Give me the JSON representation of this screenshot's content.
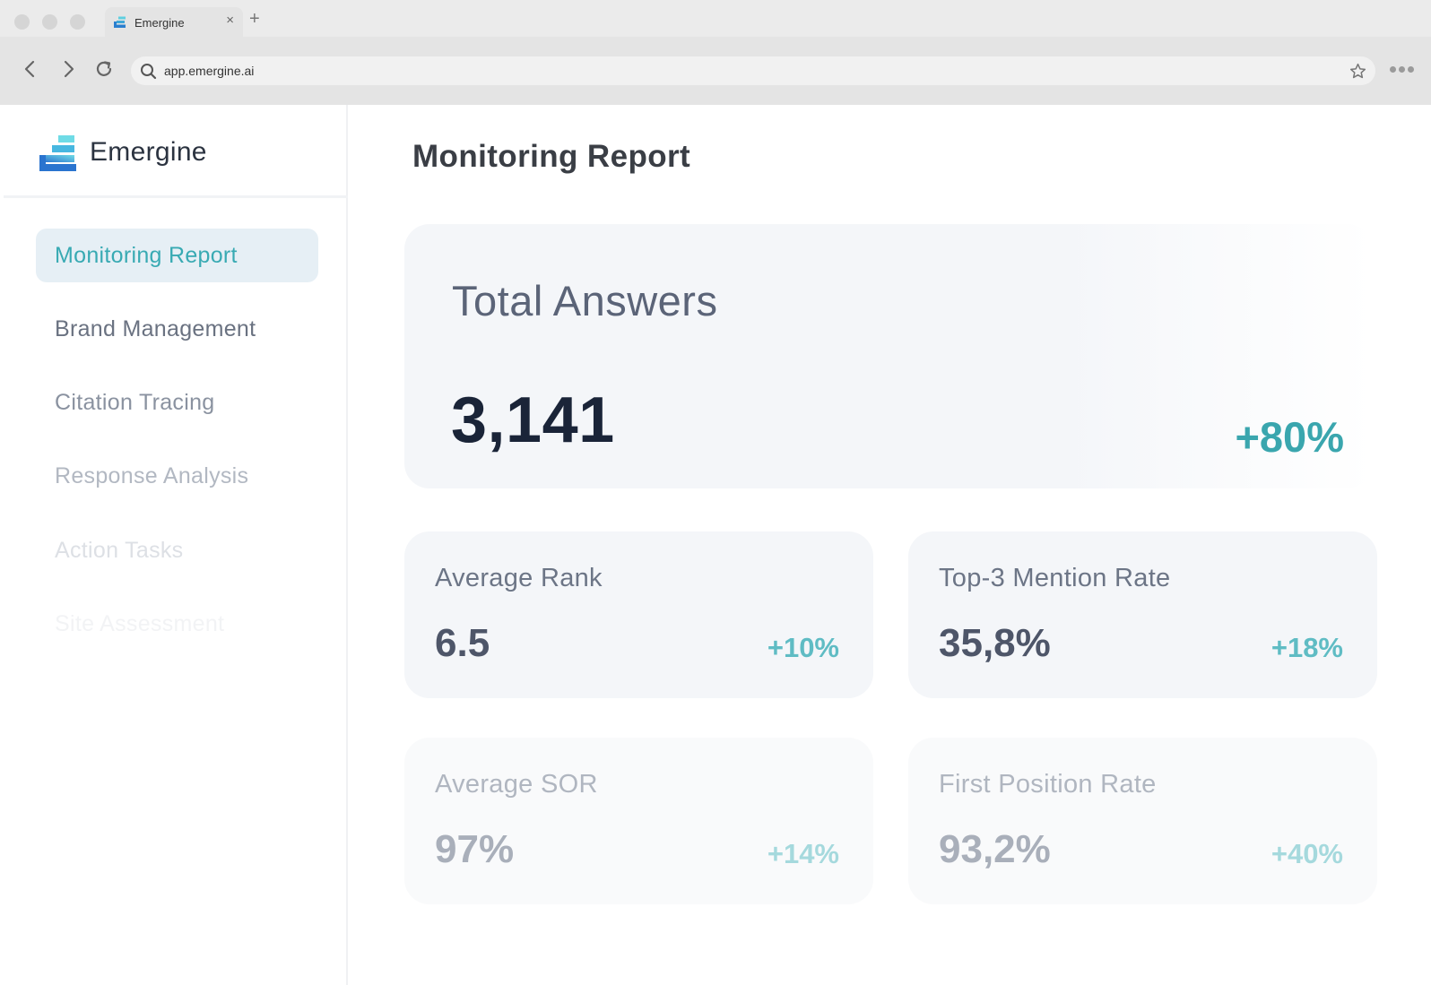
{
  "browser": {
    "tab_title": "Emergine",
    "tab_close": "×",
    "new_tab": "+",
    "url": "app.emergine.ai"
  },
  "sidebar": {
    "brand": "Emergine",
    "items": [
      {
        "label": "Monitoring Report",
        "active": true
      },
      {
        "label": "Brand Management"
      },
      {
        "label": "Citation Tracing"
      },
      {
        "label": "Response Analysis"
      },
      {
        "label": "Action Tasks"
      },
      {
        "label": "Site Assessment"
      }
    ]
  },
  "main": {
    "title": "Monitoring Report",
    "hero": {
      "label": "Total Answers",
      "value": "3,141",
      "change": "+80%"
    },
    "cards": [
      {
        "label": "Average Rank",
        "value": "6.5",
        "change": "+10%"
      },
      {
        "label": "Top-3 Mention Rate",
        "value": "35,8%",
        "change": "+18%"
      },
      {
        "label": "Average SOR",
        "value": "97%",
        "change": "+14%"
      },
      {
        "label": "First Position Rate",
        "value": "93,2%",
        "change": "+40%"
      }
    ]
  },
  "colors": {
    "accent": "#38aab3",
    "active_bg": "#e6eff5",
    "hero_value": "#1a2438"
  }
}
